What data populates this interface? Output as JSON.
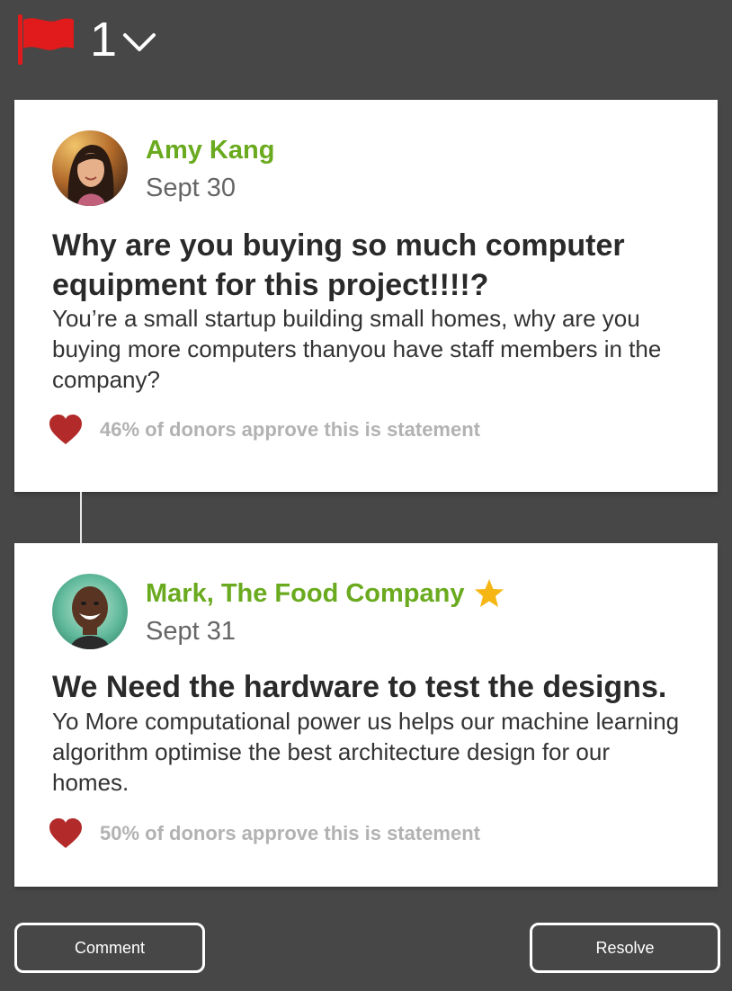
{
  "header": {
    "flag_icon": "red-flag-icon",
    "flag_count": "1",
    "dropdown_icon": "chevron-down-icon"
  },
  "colors": {
    "background": "#474747",
    "card": "#ffffff",
    "author_name": "#6aaa1f",
    "heart": "#b22a2a",
    "flag": "#e11b1b",
    "star": "#f5b614",
    "approval_text": "#b2b2b2"
  },
  "posts": [
    {
      "author": "Amy Kang",
      "verified": false,
      "date": "Sept 30",
      "title": "Why are you buying so much computer equipment for this project!!!!?",
      "body": "You’re a small startup building small homes, why are you buying more computers thanyou have staff members in the company?",
      "approval_icon": "heart-icon",
      "approval_text": "46% of donors approve this is statement"
    },
    {
      "author": "Mark, The Food Company",
      "verified": true,
      "badge_icon": "star-icon",
      "date": "Sept 31",
      "title": "We Need the hardware to test the designs.",
      "body": "Yo More computational power us helps our machine learning algorithm optimise the best architecture design for our homes.",
      "approval_icon": "heart-icon",
      "approval_text": "50% of donors approve this is statement"
    }
  ],
  "actions": {
    "comment_label": "Comment",
    "resolve_label": "Resolve"
  }
}
